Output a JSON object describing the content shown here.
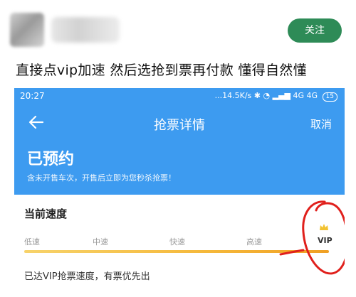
{
  "post": {
    "follow_label": "关注",
    "text": "直接点vip加速 然后选抢到票再付款 懂得自然懂"
  },
  "phone": {
    "status": {
      "time": "20:27",
      "network": "...14.5K/s",
      "signal": "4G 4G",
      "battery": "15"
    },
    "nav": {
      "title": "抢票详情",
      "cancel_label": "取消"
    },
    "header": {
      "status": "已预约",
      "notice": "含未开售车次，开售后立即为您秒杀抢票！"
    },
    "speed": {
      "title": "当前速度",
      "levels": [
        "低速",
        "中速",
        "快速",
        "高速",
        "VIP"
      ],
      "current_level": "VIP",
      "description": "已达VIP抢票速度，有票优先出"
    }
  },
  "colors": {
    "follow_button": "#2e8b57",
    "header_blue": "#3d9bf0",
    "progress_gold": "#f5b83a",
    "annotation_red": "#e0201c"
  }
}
